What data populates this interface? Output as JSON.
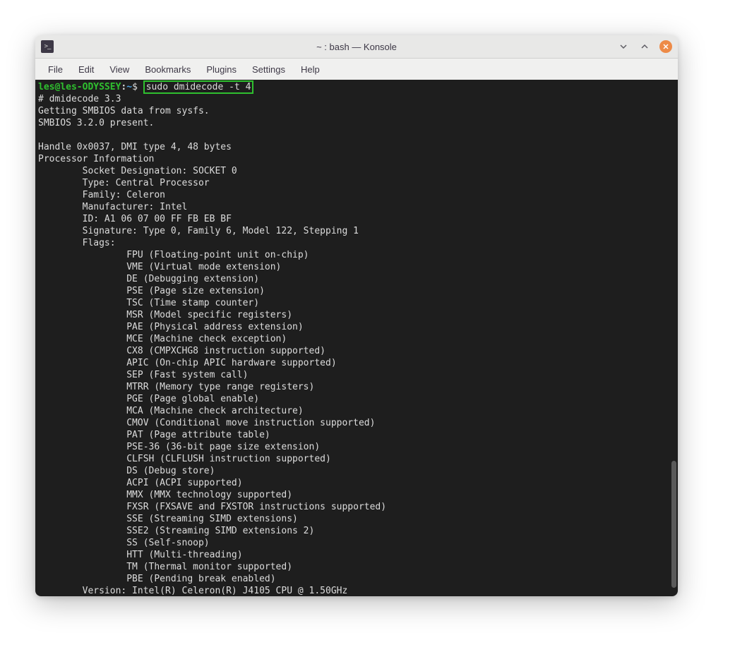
{
  "title": "~ : bash — Konsole",
  "menu": {
    "file": "File",
    "edit": "Edit",
    "view": "View",
    "bookmarks": "Bookmarks",
    "plugins": "Plugins",
    "settings": "Settings",
    "help": "Help"
  },
  "prompt": {
    "userhost": "les@les-ODYSSEY",
    "colon": ":",
    "path": "~",
    "dollar": "$"
  },
  "command": "sudo dmidecode -t 4",
  "output": {
    "l1": "# dmidecode 3.3",
    "l2": "Getting SMBIOS data from sysfs.",
    "l3": "SMBIOS 3.2.0 present.",
    "l4": "",
    "l5": "Handle 0x0037, DMI type 4, 48 bytes",
    "l6": "Processor Information",
    "l7": "        Socket Designation: SOCKET 0",
    "l8": "        Type: Central Processor",
    "l9": "        Family: Celeron",
    "l10": "        Manufacturer: Intel",
    "l11": "        ID: A1 06 07 00 FF FB EB BF",
    "l12": "        Signature: Type 0, Family 6, Model 122, Stepping 1",
    "l13": "        Flags:",
    "l14": "                FPU (Floating-point unit on-chip)",
    "l15": "                VME (Virtual mode extension)",
    "l16": "                DE (Debugging extension)",
    "l17": "                PSE (Page size extension)",
    "l18": "                TSC (Time stamp counter)",
    "l19": "                MSR (Model specific registers)",
    "l20": "                PAE (Physical address extension)",
    "l21": "                MCE (Machine check exception)",
    "l22": "                CX8 (CMPXCHG8 instruction supported)",
    "l23": "                APIC (On-chip APIC hardware supported)",
    "l24": "                SEP (Fast system call)",
    "l25": "                MTRR (Memory type range registers)",
    "l26": "                PGE (Page global enable)",
    "l27": "                MCA (Machine check architecture)",
    "l28": "                CMOV (Conditional move instruction supported)",
    "l29": "                PAT (Page attribute table)",
    "l30": "                PSE-36 (36-bit page size extension)",
    "l31": "                CLFSH (CLFLUSH instruction supported)",
    "l32": "                DS (Debug store)",
    "l33": "                ACPI (ACPI supported)",
    "l34": "                MMX (MMX technology supported)",
    "l35": "                FXSR (FXSAVE and FXSTOR instructions supported)",
    "l36": "                SSE (Streaming SIMD extensions)",
    "l37": "                SSE2 (Streaming SIMD extensions 2)",
    "l38": "                SS (Self-snoop)",
    "l39": "                HTT (Multi-threading)",
    "l40": "                TM (Thermal monitor supported)",
    "l41": "                PBE (Pending break enabled)",
    "l42": "        Version: Intel(R) Celeron(R) J4105 CPU @ 1.50GHz"
  }
}
